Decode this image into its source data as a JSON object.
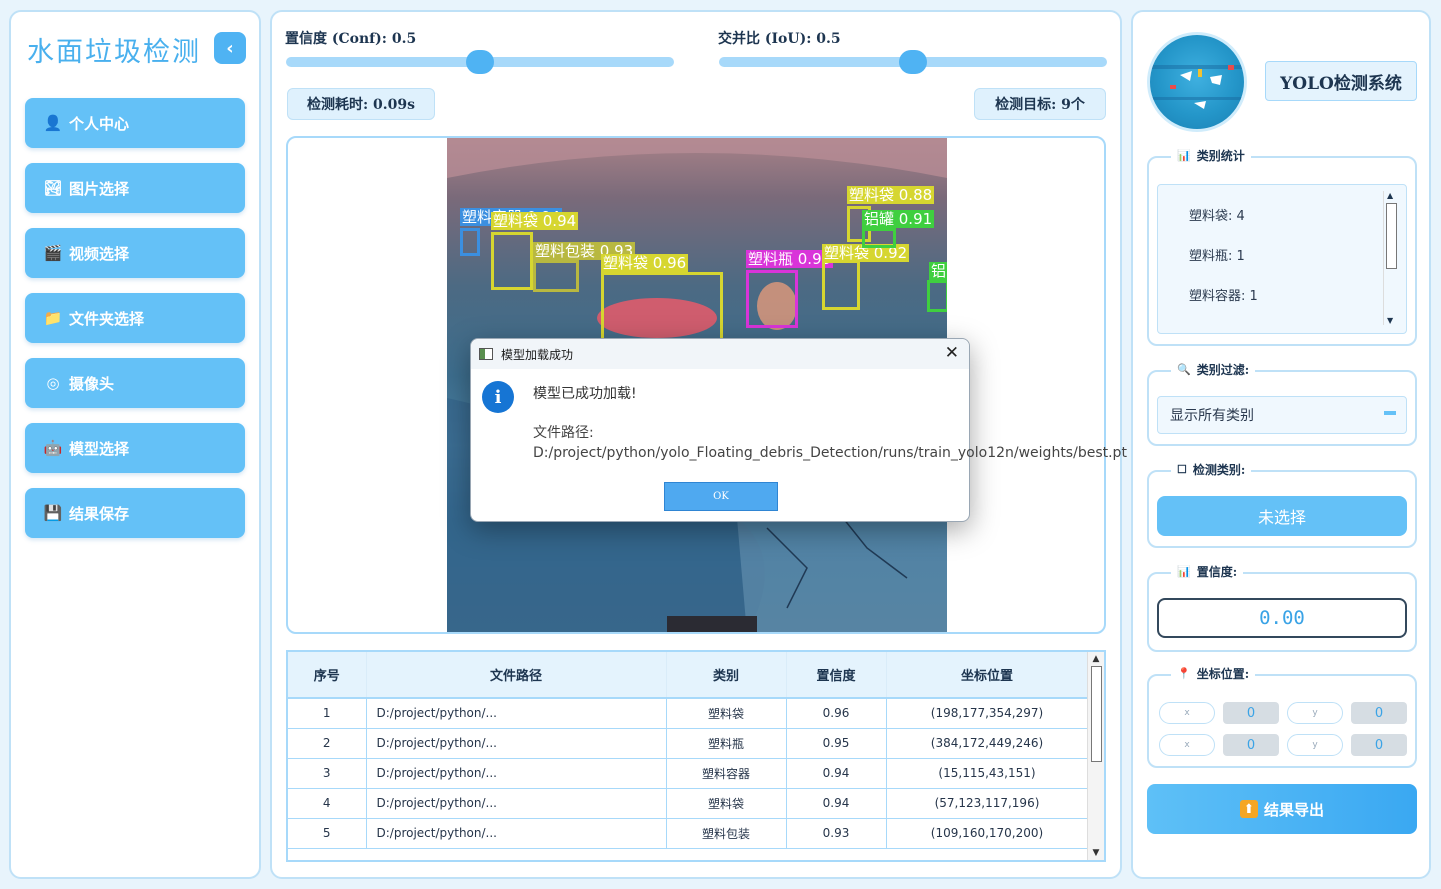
{
  "sidebar": {
    "title": "水面垃圾检测",
    "collapse_icon": "chevron-left-icon",
    "nav": [
      {
        "label": "个人中心",
        "icon": "user-icon",
        "glyph": "👤"
      },
      {
        "label": "图片选择",
        "icon": "image-icon",
        "glyph": "🏞"
      },
      {
        "label": "视频选择",
        "icon": "clapperboard-icon",
        "glyph": "🎬"
      },
      {
        "label": "文件夹选择",
        "icon": "folder-icon",
        "glyph": "📁"
      },
      {
        "label": "摄像头",
        "icon": "webcam-icon",
        "glyph": "◎"
      },
      {
        "label": "模型选择",
        "icon": "robot-icon",
        "glyph": "🤖"
      },
      {
        "label": "结果保存",
        "icon": "floppy-disk-icon",
        "glyph": "💾"
      }
    ]
  },
  "controls": {
    "conf_label": "置信度 (Conf): 0.5",
    "conf_value": 0.5,
    "iou_label": "交并比 (IoU): 0.5",
    "iou_value": 0.5,
    "time_label": "检测耗时: 0.09s",
    "targets_label": "检测目标: 9个"
  },
  "detections_overlay": [
    {
      "label": "塑料容器 0.94",
      "color": "#3b8fe0"
    },
    {
      "label": "塑料袋 0.94",
      "color": "#d6d630"
    },
    {
      "label": "塑料包装 0.93",
      "color": "#b8b840"
    },
    {
      "label": "塑料袋 0.96",
      "color": "#d6d630"
    },
    {
      "label": "塑料瓶 0.95",
      "color": "#d934d9"
    },
    {
      "label": "塑料袋 0.92",
      "color": "#d6d630"
    },
    {
      "label": "塑料袋 0.88",
      "color": "#d6d630"
    },
    {
      "label": "铝罐 0.91",
      "color": "#3fcf3f"
    },
    {
      "label": "铝",
      "color": "#3fcf3f"
    }
  ],
  "table": {
    "headers": [
      "序号",
      "文件路径",
      "类别",
      "置信度",
      "坐标位置"
    ],
    "rows": [
      [
        "1",
        "D:/project/python/...",
        "塑料袋",
        "0.96",
        "(198,177,354,297)"
      ],
      [
        "2",
        "D:/project/python/...",
        "塑料瓶",
        "0.95",
        "(384,172,449,246)"
      ],
      [
        "3",
        "D:/project/python/...",
        "塑料容器",
        "0.94",
        "(15,115,43,151)"
      ],
      [
        "4",
        "D:/project/python/...",
        "塑料袋",
        "0.94",
        "(57,123,117,196)"
      ],
      [
        "5",
        "D:/project/python/...",
        "塑料包装",
        "0.93",
        "(109,160,170,200)"
      ]
    ]
  },
  "dialog": {
    "title": "模型加载成功",
    "message": "模型已成功加载!",
    "path_text": "文件路径: D:/project/python/yolo_Floating_debris_Detection/runs/train_yolo12n/weights/best.pt",
    "ok_label": "OK",
    "close_glyph": "✕",
    "info_glyph": "i"
  },
  "right": {
    "system_title": "YOLO检测系统",
    "stats_title": "类别统计",
    "stats_items": [
      "塑料袋: 4",
      "塑料瓶: 1",
      "塑料容器: 1"
    ],
    "filter_title": "类别过滤:",
    "filter_value": "显示所有类别",
    "detect_class_title": "检测类别:",
    "detect_class_button": "未选择",
    "conf_title": "置信度:",
    "conf_value": "0.00",
    "coord_title": "坐标位置:",
    "coords": [
      {
        "axis_glyph": "x",
        "value": "0"
      },
      {
        "axis_glyph": "y",
        "value": "0"
      },
      {
        "axis_glyph": "x",
        "value": "0"
      },
      {
        "axis_glyph": "y",
        "value": "0"
      }
    ],
    "export_label": "结果导出",
    "export_icon_glyph": "⬆"
  },
  "colors": {
    "accent": "#64c1f7",
    "accent_dark": "#4fb3f3",
    "border": "#bfe1f7",
    "title_blue": "#49b0ee"
  }
}
